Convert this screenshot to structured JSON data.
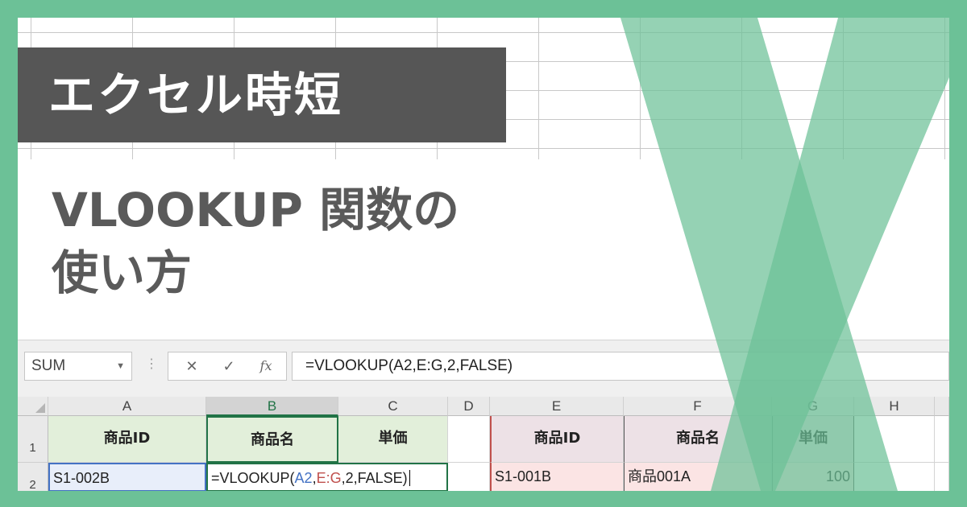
{
  "banner": {
    "label": "エクセル時短",
    "heading_line1": "VLOOKUP 関数の",
    "heading_line2": "使い方"
  },
  "formula_bar": {
    "name_box": "SUM",
    "cancel_icon": "✕",
    "enter_icon": "✓",
    "fx_icon": "fx",
    "formula": "=VLOOKUP(A2,E:G,2,FALSE)"
  },
  "sheet": {
    "columns": [
      "A",
      "B",
      "C",
      "D",
      "E",
      "F",
      "G",
      "H"
    ],
    "rows": [
      "1",
      "2"
    ],
    "row1": {
      "a": "商品ID",
      "b": "商品名",
      "c": "単価",
      "e": "商品ID",
      "f": "商品名",
      "g": "単価"
    },
    "row2": {
      "a": "S1-002B",
      "b_prefix": "=VLOOKUP(",
      "b_ref1": "A2",
      "b_comma1": ",",
      "b_ref2": "E:G",
      "b_suffix": ",2,FALSE)",
      "e": "S1-001B",
      "f": "商品001A",
      "g": "100"
    }
  },
  "colors": {
    "frame": "#6cc197",
    "banner_bg": "#565656",
    "heading_text": "#5a5a5a",
    "x_logo": "#6cc197"
  },
  "icons": {
    "logo": "excel-x-logo-icon",
    "dropdown": "chevron-down-icon"
  }
}
